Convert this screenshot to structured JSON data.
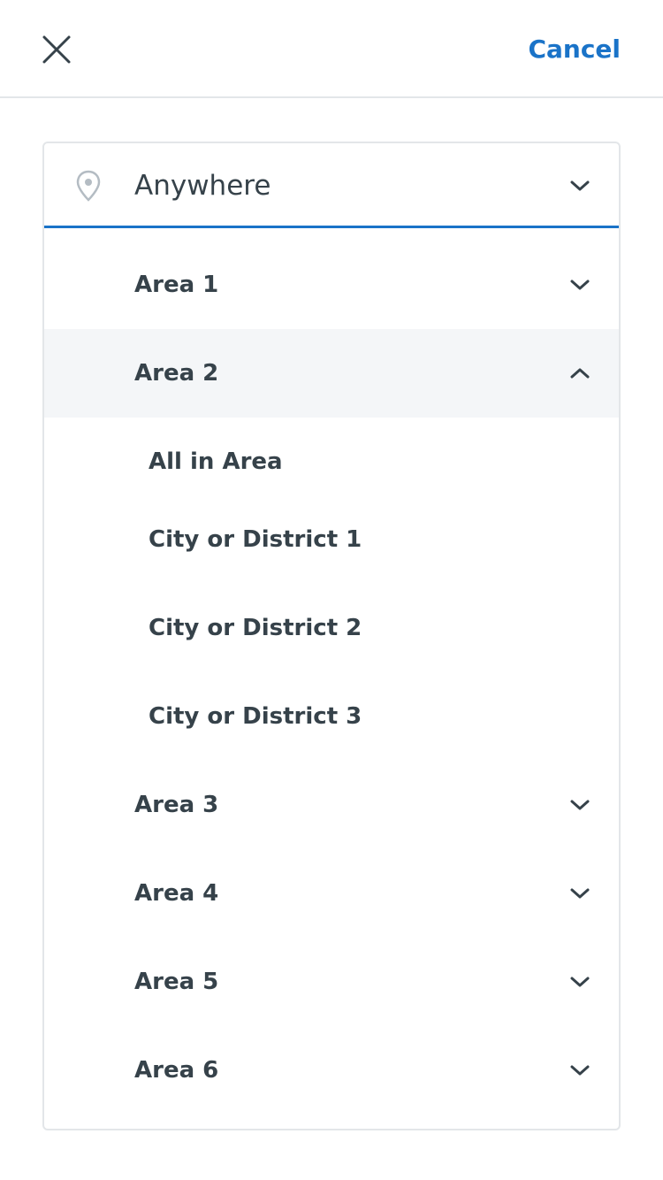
{
  "header": {
    "close_icon": "close-icon",
    "cancel_label": "Cancel"
  },
  "location": {
    "icon": "map-pin-icon",
    "selected": "Anywhere"
  },
  "areas": [
    {
      "label": "Area 1",
      "expanded": false
    },
    {
      "label": "Area 2",
      "expanded": true,
      "children": [
        "All in Area",
        "City or District 1",
        "City or District 2",
        "City or District 3"
      ]
    },
    {
      "label": "Area 3",
      "expanded": false
    },
    {
      "label": "Area 4",
      "expanded": false
    },
    {
      "label": "Area 5",
      "expanded": false
    },
    {
      "label": "Area 6",
      "expanded": false
    }
  ],
  "colors": {
    "accent": "#1a73c8",
    "text": "#36424a",
    "border": "#e3e6e9",
    "active_row": "#f4f6f8"
  }
}
